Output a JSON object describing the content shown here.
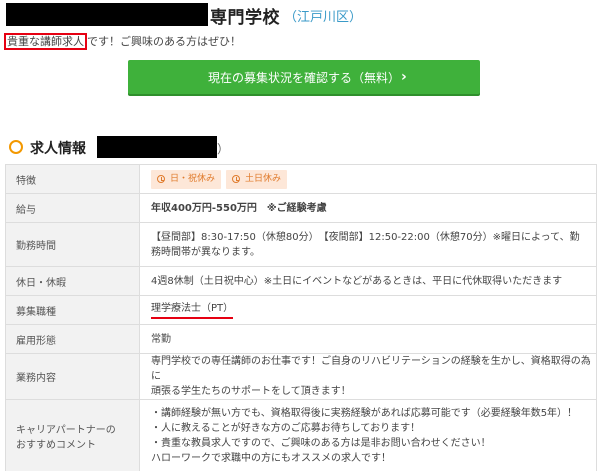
{
  "header": {
    "school_type": "専門学校",
    "ward": "（江戸川区）"
  },
  "intro": {
    "highlight": "貴重な講師求人",
    "rest": "です！ご興味のある方はぜひ！"
  },
  "cta": {
    "label": "現在の募集状況を確認する（無料）",
    "arrow": "›"
  },
  "section": {
    "title": "求人情報",
    "paren_open": "（",
    "paren_close": "）"
  },
  "table": {
    "rows": [
      {
        "label": "特徴",
        "badges": [
          "日・祝休み",
          "土日休み"
        ]
      },
      {
        "label": "給与",
        "value": "年収400万円-550万円　※ご経験考慮"
      },
      {
        "label": "勤務時間",
        "value_lines": [
          "【昼間部】8:30-17:50（休憩80分）　【夜間部】12:50-22:00（休憩70分）※曜日によって、勤",
          "務時間帯が異なります。"
        ]
      },
      {
        "label": "休日・休暇",
        "value": "4週8休制（土日祝中心）※土日にイベントなどがあるときは、平日に代休取得いただきます"
      },
      {
        "label": "募集職種",
        "value": "理学療法士（PT）"
      },
      {
        "label": "雇用形態",
        "value": "常勤"
      },
      {
        "label": "業務内容",
        "value_lines": [
          "専門学校での専任講師のお仕事です！ご自身のリハビリテーションの経験を生かし、資格取得の為に",
          "頑張る学生たちのサポートをして頂きます！"
        ]
      },
      {
        "label_lines": [
          "キャリアパートナーの",
          "おすすめコメント"
        ],
        "value_lines": [
          "・講師経験が無い方でも、資格取得後に実務経験があれば応募可能です（必要経験年数5年）！",
          "・人に教えることが好きな方のご応募お待ちしております！",
          "・貴重な教員求人ですので、ご興味のある方は是非お問い合わせください！",
          "ハローワークで求職中の方にもオススメの求人です！"
        ]
      }
    ]
  },
  "colors": {
    "accent_green": "#3fb13b",
    "salary_orange": "#e8730a",
    "badge_bg": "#fde7d8",
    "ward_blue": "#3a9ac8",
    "highlight_red": "#e60012"
  }
}
